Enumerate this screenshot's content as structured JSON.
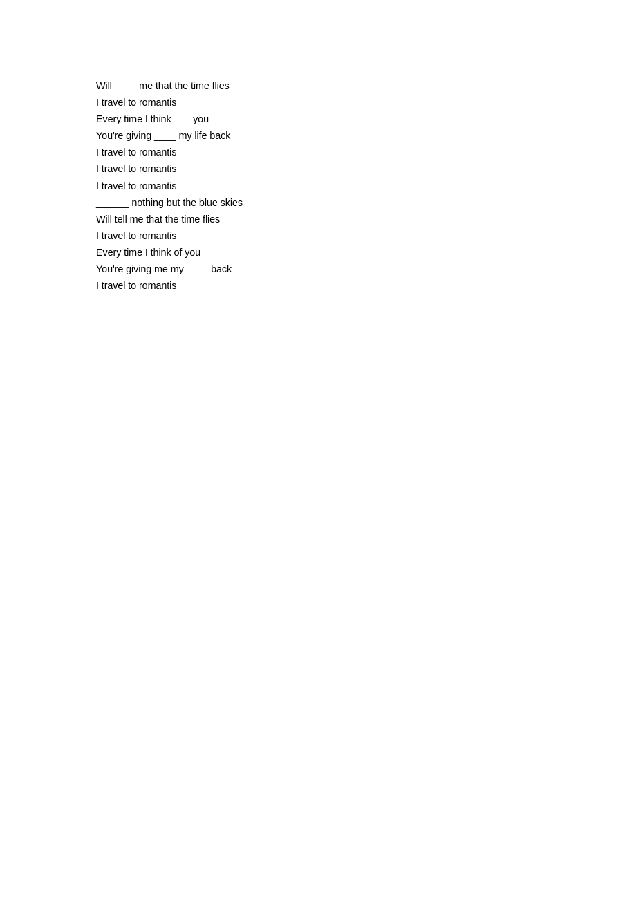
{
  "document": {
    "lines": [
      "Will ____ me that the time flies",
      "I travel to romantis",
      "Every time I think ___ you",
      "You're giving ____ my life back",
      "I travel to romantis",
      "I travel to romantis",
      "I travel to romantis",
      "______ nothing but the blue skies",
      "Will tell me that the time flies",
      "I travel to romantis",
      "Every time I think of you",
      "You're giving me my ____ back",
      "I travel to romantis"
    ]
  }
}
